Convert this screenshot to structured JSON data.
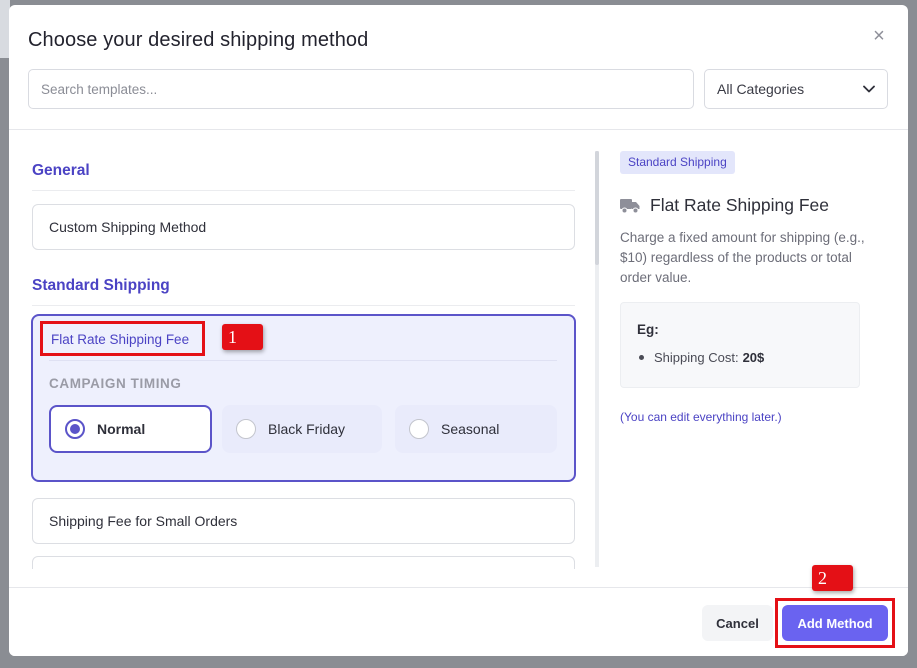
{
  "modal": {
    "title": "Choose your desired shipping method",
    "close_glyph": "×",
    "search_placeholder": "Search templates...",
    "category_select": {
      "selected": "All Categories",
      "icon": "chevron-down-icon"
    }
  },
  "left_pane": {
    "sections": [
      {
        "title": "General",
        "items": [
          "Custom Shipping Method"
        ]
      },
      {
        "title": "Standard Shipping"
      }
    ],
    "selected_item": {
      "title": "Flat Rate Shipping Fee",
      "timing_label": "CAMPAIGN TIMING",
      "timing_options": [
        {
          "label": "Normal",
          "checked": true
        },
        {
          "label": "Black Friday",
          "checked": false
        },
        {
          "label": "Seasonal",
          "checked": false
        }
      ]
    },
    "next_item": "Shipping Fee for Small Orders"
  },
  "right_pane": {
    "tag": "Standard Shipping",
    "icon": "truck-icon",
    "title": "Flat Rate Shipping Fee",
    "description": "Charge a fixed amount for shipping (e.g., $10) regardless of the products or total order value.",
    "example": {
      "label": "Eg:",
      "item_label": "Shipping Cost:",
      "item_value": "20$"
    },
    "note": "(You can edit everything later.)"
  },
  "footer": {
    "cancel_label": "Cancel",
    "add_label": "Add Method"
  },
  "annotations": {
    "badge_1": "1",
    "badge_2": "2"
  },
  "colors": {
    "accent": "#4b43c4",
    "primary_button": "#6a63f0",
    "annotation_red": "#e41016"
  }
}
